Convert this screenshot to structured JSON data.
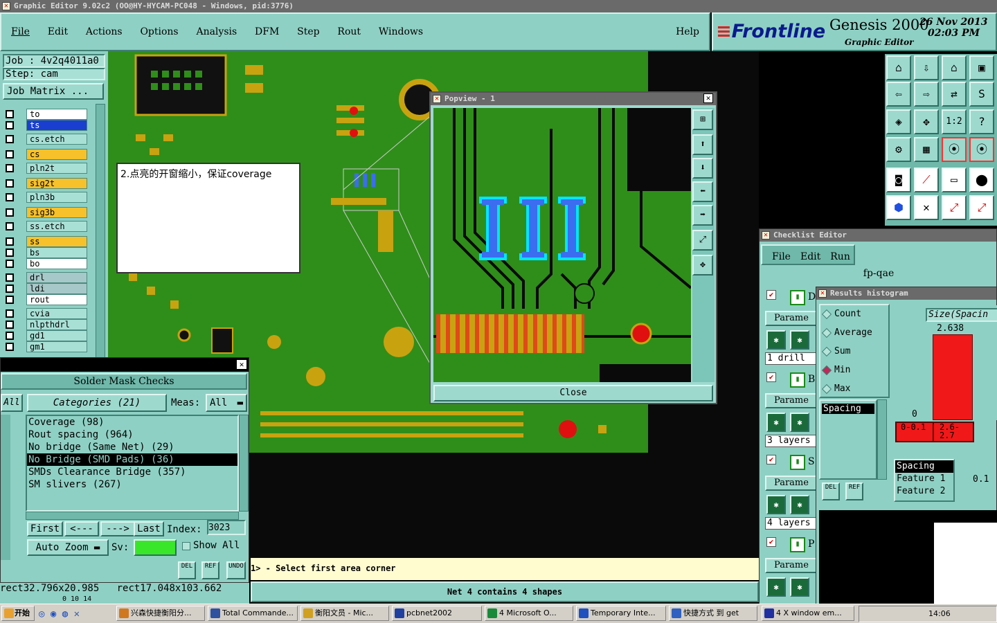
{
  "window": {
    "title": "Graphic Editor 9.02c2  (OO@HY-HYCAM-PC048 - Windows, pid:3776)"
  },
  "menu": {
    "items": [
      "File",
      "Edit",
      "Actions",
      "Options",
      "Analysis",
      "DFM",
      "Step",
      "Rout",
      "Windows"
    ],
    "help": "Help"
  },
  "brand": {
    "logo": "Frontline",
    "product": "Genesis 2000",
    "subtitle": "Graphic Editor",
    "date": "26 Nov 2013",
    "time": "02:03 PM"
  },
  "job": {
    "job_label": "Job : 4v2q4011a0",
    "step_label": "Step: cam",
    "matrix_button": "Job Matrix ..."
  },
  "layers": [
    {
      "name": "to",
      "style": "w"
    },
    {
      "name": "ts",
      "style": "sel"
    },
    {
      "name": "cs.etch",
      "style": ""
    },
    {
      "name": "cs",
      "style": "y"
    },
    {
      "name": "pln2t",
      "style": ""
    },
    {
      "name": "sig2t",
      "style": "y"
    },
    {
      "name": "pln3b",
      "style": ""
    },
    {
      "name": "sig3b",
      "style": "y"
    },
    {
      "name": "ss.etch",
      "style": ""
    },
    {
      "name": "ss",
      "style": "y"
    },
    {
      "name": "bs",
      "style": ""
    },
    {
      "name": "bo",
      "style": "w"
    },
    {
      "name": "drl",
      "style": "g"
    },
    {
      "name": "ldi",
      "style": "g"
    },
    {
      "name": "rout",
      "style": "w"
    },
    {
      "name": "cvia",
      "style": ""
    },
    {
      "name": "nlpthdrl",
      "style": ""
    },
    {
      "name": "gd1",
      "style": ""
    },
    {
      "name": "gm1",
      "style": ""
    }
  ],
  "note": {
    "text": "2.点亮的开窗缩小，保证coverage"
  },
  "popview": {
    "title": "Popview - 1",
    "close": "Close"
  },
  "solder": {
    "title": "Solder Mask Checks",
    "all_btn": "All",
    "categories": "Categories (21)",
    "meas_label": "Meas:",
    "meas_value": "All",
    "items": [
      "Coverage (98)",
      "Rout spacing (964)",
      "No bridge (Same Net) (29)",
      "No Bridge (SMD Pads) (36)",
      "SMDs Clearance Bridge (357)",
      "SM slivers (267)"
    ],
    "selected_index": 3,
    "first": "First",
    "prev": "<---",
    "next": "--->",
    "last": "Last",
    "index_label": "Index:",
    "index_value": "3023",
    "auto_zoom": "Auto Zoom",
    "sv_label": "Sv:",
    "show_all": "Show All",
    "del": "DEL",
    "ref": "REF",
    "undo": "UNDO"
  },
  "coords": {
    "left": "rect32.796x20.985",
    "right": "rect17.048x103.662",
    "below": "0 10 14"
  },
  "status": {
    "prompt": "1> - Select first area corner",
    "net": "Net 4 contains 4 shapes"
  },
  "checklist": {
    "title": "Checklist Editor",
    "menu": [
      "File",
      "Edit",
      "Run"
    ],
    "name": "fp-qae",
    "rows": [
      {
        "letter": "D",
        "param": "Parame",
        "layers": "1 drill"
      },
      {
        "letter": "B",
        "param": "Parame",
        "layers": "3 layers"
      },
      {
        "letter": "S",
        "param": "Parame",
        "layers": "4 layers"
      },
      {
        "letter": "P",
        "param": "Parame",
        "layers": ""
      }
    ]
  },
  "histogram": {
    "title": "Results histogram",
    "options": [
      "Count",
      "Average",
      "Sum",
      "Min",
      "Max"
    ],
    "selected": "Min",
    "metric": "Spacing",
    "axis_title": "Size(Spacin",
    "bar_value": "2.638",
    "zero": "0",
    "bins": [
      "0-0.1",
      "2.6-2.7"
    ],
    "sel_list": [
      "Spacing",
      "Feature 1",
      "Feature 2"
    ],
    "side_value": "0.1",
    "del": "DEL",
    "ref": "REF"
  },
  "taskbar": {
    "start": "开始",
    "tasks": [
      "兴森快捷衡阳分...",
      "Total Commande...",
      "衡阳文员 - Mic...",
      "pcbnet2002",
      "4 Microsoft O...",
      "Temporary Inte...",
      "快捷方式 到 get",
      "4 X window em..."
    ],
    "clock": "14:06"
  },
  "colors": {
    "copper": "#2f8e1a",
    "pad": "#c9a210",
    "teal": "#8fd0c4",
    "highlight": "#3a6df0"
  }
}
